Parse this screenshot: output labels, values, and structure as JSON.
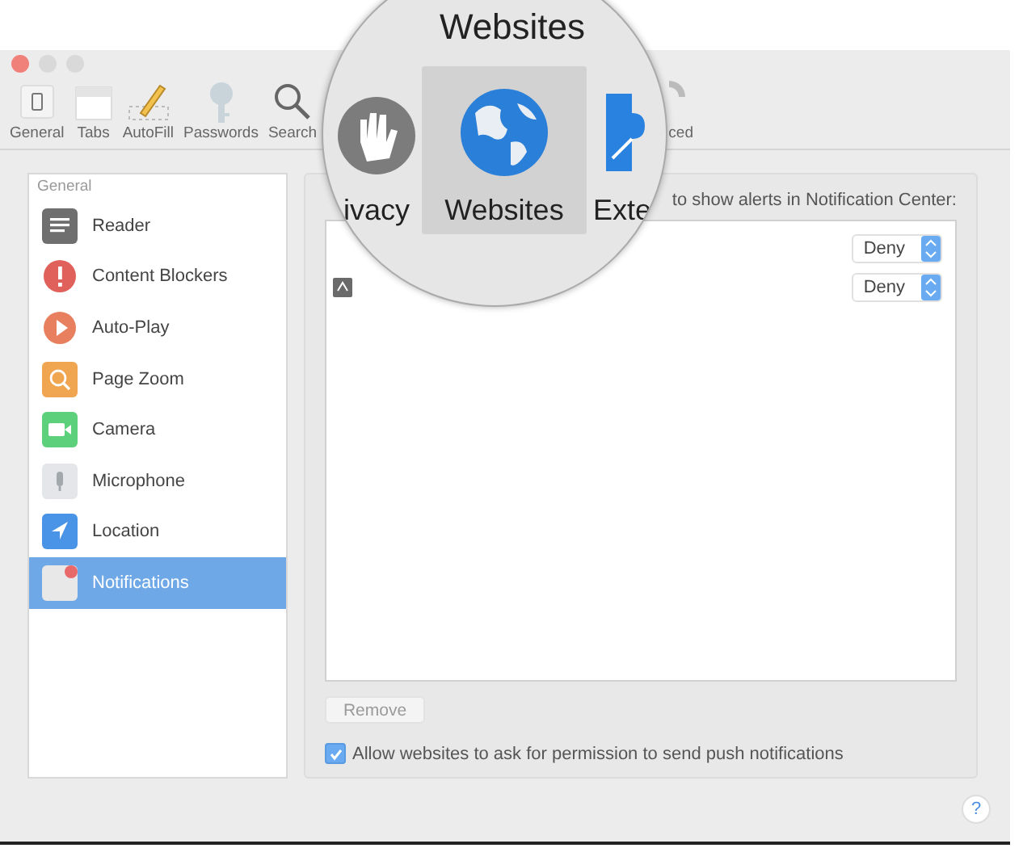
{
  "toolbar": {
    "items": [
      {
        "label": "General"
      },
      {
        "label": "Tabs"
      },
      {
        "label": "AutoFill"
      },
      {
        "label": "Passwords"
      },
      {
        "label": "Search"
      },
      {
        "label": "ced"
      }
    ]
  },
  "magnifier": {
    "title": "Websites",
    "tabs": [
      {
        "label": "ivacy",
        "selected": false
      },
      {
        "label": "Websites",
        "selected": true
      },
      {
        "label": "Exte",
        "selected": false
      }
    ]
  },
  "sidebar": {
    "heading": "General",
    "items": [
      {
        "label": "Reader",
        "selected": false
      },
      {
        "label": "Content Blockers",
        "selected": false
      },
      {
        "label": "Auto-Play",
        "selected": false
      },
      {
        "label": "Page Zoom",
        "selected": false
      },
      {
        "label": "Camera",
        "selected": false
      },
      {
        "label": "Microphone",
        "selected": false
      },
      {
        "label": "Location",
        "selected": false
      },
      {
        "label": "Notifications",
        "selected": true
      }
    ]
  },
  "panel": {
    "caption": "to show alerts in Notification Center:",
    "rows": [
      {
        "permission": "Deny",
        "has_icon": false
      },
      {
        "permission": "Deny",
        "has_icon": true
      }
    ],
    "remove_button": {
      "label": "Remove",
      "disabled": true
    },
    "push_checkbox": {
      "label": "Allow websites to ask for permission to send push notifications",
      "checked": true
    }
  },
  "help_button": "?"
}
